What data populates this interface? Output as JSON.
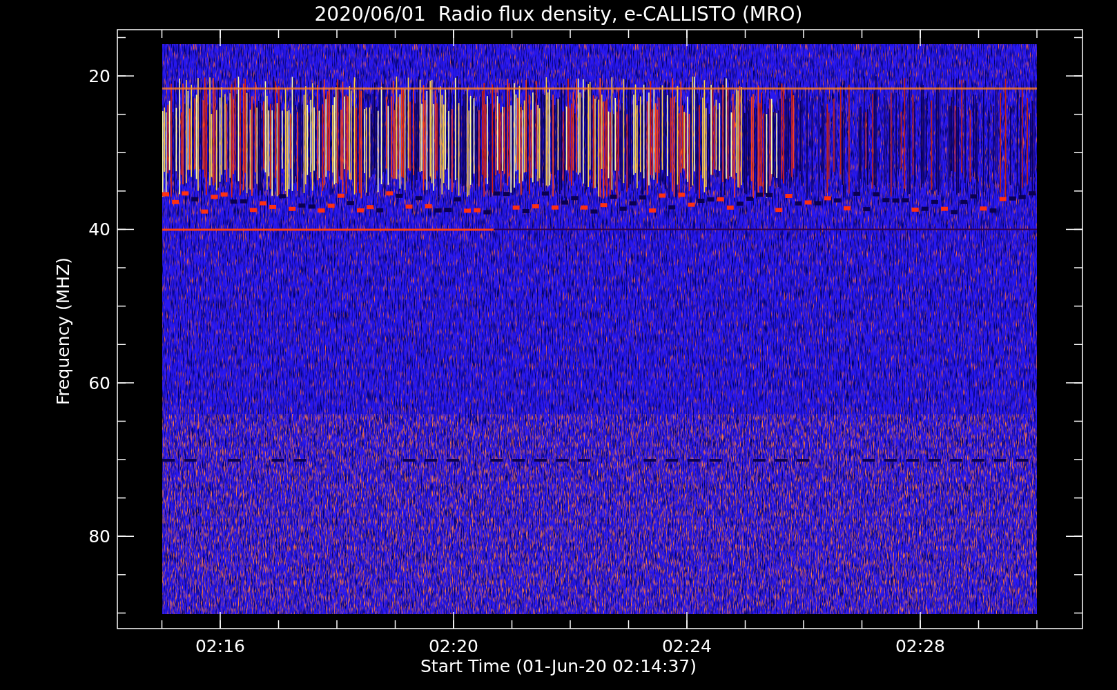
{
  "title": "2020/06/01  Radio flux density, e-CALLISTO (MRO)",
  "y_axis": {
    "label": "Frequency (MHZ)",
    "ticks": [
      "20",
      "40",
      "60",
      "80"
    ]
  },
  "x_axis": {
    "label": "Start Time (01-Jun-20 02:14:37)",
    "ticks": [
      "02:16",
      "02:20",
      "02:24",
      "02:28"
    ]
  }
}
